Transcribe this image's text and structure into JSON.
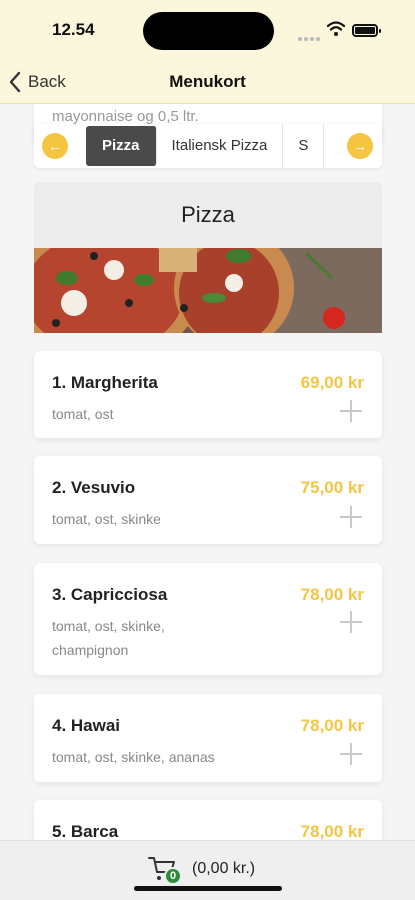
{
  "status_bar": {
    "time": "12.54"
  },
  "nav": {
    "back_label": "Back",
    "title": "Menukort"
  },
  "previous_card": {
    "text": "mayonnaise og 0,5 ltr."
  },
  "categories": [
    {
      "label": "Pizza",
      "active": true
    },
    {
      "label": "Italiensk Pizza",
      "active": false
    },
    {
      "label": "S",
      "active": false
    }
  ],
  "category_arrows": {
    "left": "←",
    "right": "→"
  },
  "section": {
    "title": "Pizza"
  },
  "items": [
    {
      "name": "1. Margherita",
      "description": "tomat, ost",
      "price": "69,00 kr"
    },
    {
      "name": "2. Vesuvio",
      "description": "tomat, ost, skinke",
      "price": "75,00 kr"
    },
    {
      "name": "3. Capricciosa",
      "description": "tomat, ost, skinke, champignon",
      "price": "78,00 kr"
    },
    {
      "name": "4. Hawai",
      "description": "tomat, ost, skinke, ananas",
      "price": "78,00 kr"
    },
    {
      "name": "5. Barca",
      "description": "",
      "price": "78,00 kr"
    }
  ],
  "cart": {
    "count": "0",
    "total": "(0,00 kr.)"
  },
  "colors": {
    "accent": "#f5c542",
    "header_bg": "#fbf7dc",
    "active_tab": "#4a4a4a",
    "cart_badge": "#2e8b3d"
  }
}
